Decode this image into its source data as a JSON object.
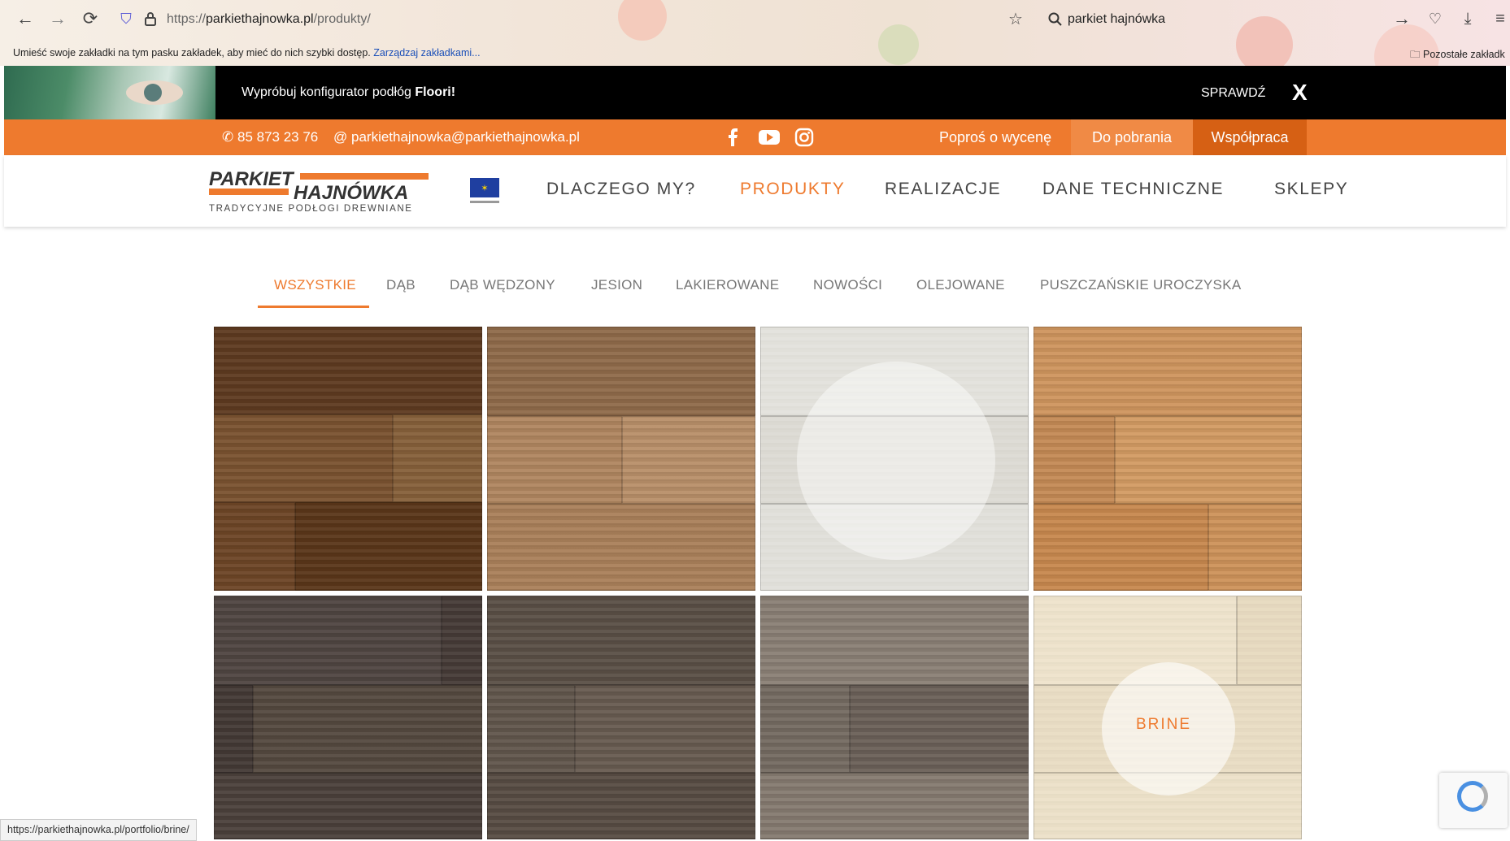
{
  "browser": {
    "url_prefix": "https://",
    "url_host": "parkiethajnowka.pl",
    "url_path": "/produkty/",
    "search_query": "parkiet hajnówka",
    "bookmarks_message": "Umieść swoje zakładki na tym pasku zakładek, aby mieć do nich szybki dostęp.",
    "bookmarks_link": "Zarządzaj zakładkami...",
    "other_bookmarks": "Pozostałe zakładk",
    "status_url": "https://parkiethajnowka.pl/portfolio/brine/"
  },
  "promo": {
    "text": "Wypróbuj konfigurator podłóg ",
    "brand": "Floori!",
    "cta": "SPRAWDŹ",
    "close": "X"
  },
  "topbar": {
    "phone": "85 873 23 76",
    "email": "parkiethajnowka@parkiethajnowka.pl",
    "quote": "Poproś o wycenę",
    "downloads": "Do pobrania",
    "cooperation": "Współpraca"
  },
  "header": {
    "logo_line1": "PARKIET",
    "logo_line2": "HAJNÓWKA",
    "logo_tagline": "TRADYCYJNE PODŁOGI DREWNIANE",
    "nav": [
      "DLACZEGO MY?",
      "PRODUKTY",
      "REALIZACJE",
      "DANE TECHNICZNE",
      "SKLEPY"
    ],
    "active_nav": "PRODUKTY"
  },
  "filters": {
    "items": [
      "WSZYSTKIE",
      "DĄB",
      "DĄB WĘDZONY",
      "JESION",
      "LAKIEROWANE",
      "NOWOŚCI",
      "OLEJOWANE",
      "PUSZCZAŃSKIE UROCZYSKA"
    ],
    "active": "WSZYSTKIE"
  },
  "products": {
    "hover_label": "BRINE"
  },
  "colors": {
    "accent": "#ee7a2e",
    "dark_orange": "#d66014",
    "promo_bg": "#000000"
  }
}
